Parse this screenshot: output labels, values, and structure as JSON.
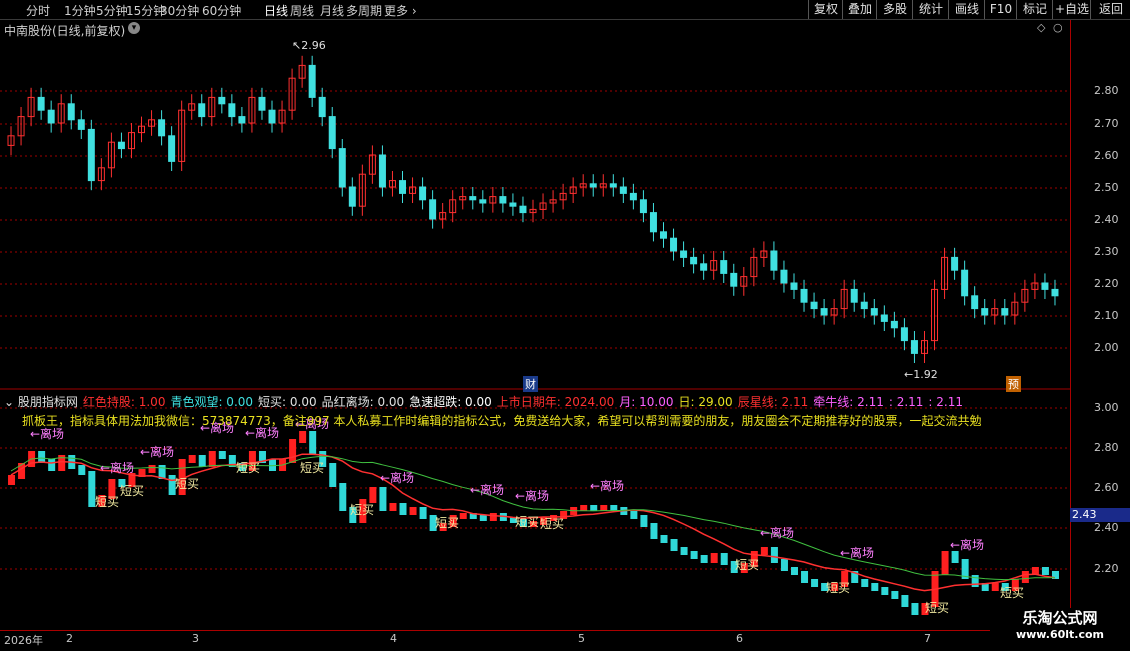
{
  "toolbar": {
    "periods": [
      "分时",
      "1分钟",
      "5分钟",
      "15分钟",
      "30分钟",
      "60分钟",
      "日线",
      "周线",
      "月线",
      "多周期",
      "更多"
    ],
    "active_period": "日线",
    "right_buttons": [
      "复权",
      "叠加",
      "多股",
      "统计",
      "画线",
      "F10",
      "标记",
      "+自选",
      "返回"
    ]
  },
  "stock": {
    "title": "中南股份(日线,前复权)"
  },
  "main_axis": {
    "ticks": [
      "2.80",
      "2.70",
      "2.60",
      "2.50",
      "2.40",
      "2.30",
      "2.20",
      "2.10",
      "2.00"
    ]
  },
  "annotations": {
    "high": "2.96",
    "low": "1.92",
    "cai": "财",
    "yu": "预"
  },
  "indicator": {
    "name": "股朋指标网",
    "fields": [
      {
        "label": "红色持股: 1.00",
        "color": "#ff3030"
      },
      {
        "label": "青色观望: 0.00",
        "color": "#40e0e0"
      },
      {
        "label": "短买: 0.00",
        "color": "#e0e0e0"
      },
      {
        "label": "品红离场: 0.00",
        "color": "#e0e0e0"
      },
      {
        "label": "急速超跌: 0.00",
        "color": "#ffffff"
      },
      {
        "label": "上市日期年: 2024.00",
        "color": "#ff3030"
      },
      {
        "label": "月: 10.00",
        "color": "#ff60ff"
      },
      {
        "label": "日: 29.00",
        "color": "#e8e020"
      },
      {
        "label": "辰星线: 2.11",
        "color": "#ff3030"
      },
      {
        "label": "牵牛线: 2.11",
        "color": "#ff60ff"
      },
      {
        "label": ": 2.11",
        "color": "#ff60ff"
      },
      {
        "label": ": 2.11",
        "color": "#ff60ff"
      }
    ],
    "note": "抓板王，指标具体用法加我微信：573874773，备注997 本人私募工作时编辑的指标公式，免费送给大家，希望可以帮到需要的朋友，朋友圈会不定期推荐好的股票，一起交流共勉",
    "axis_ticks": [
      "3.00",
      "2.80",
      "2.60",
      "2.40",
      "2.20"
    ],
    "signals": {
      "exit": "←离场",
      "buy": "短买"
    },
    "current_price": "2.43"
  },
  "date_axis": {
    "labels": [
      "2026年",
      "2",
      "3",
      "4",
      "5",
      "6",
      "7"
    ]
  },
  "watermark": {
    "title": "乐淘公式网",
    "url": "www.60lt.com"
  },
  "colors": {
    "up": "#ff3030",
    "down": "#40e0e0",
    "grid": "#a00000",
    "ma_red": "#ff3030",
    "ma_green": "#40c040"
  }
}
